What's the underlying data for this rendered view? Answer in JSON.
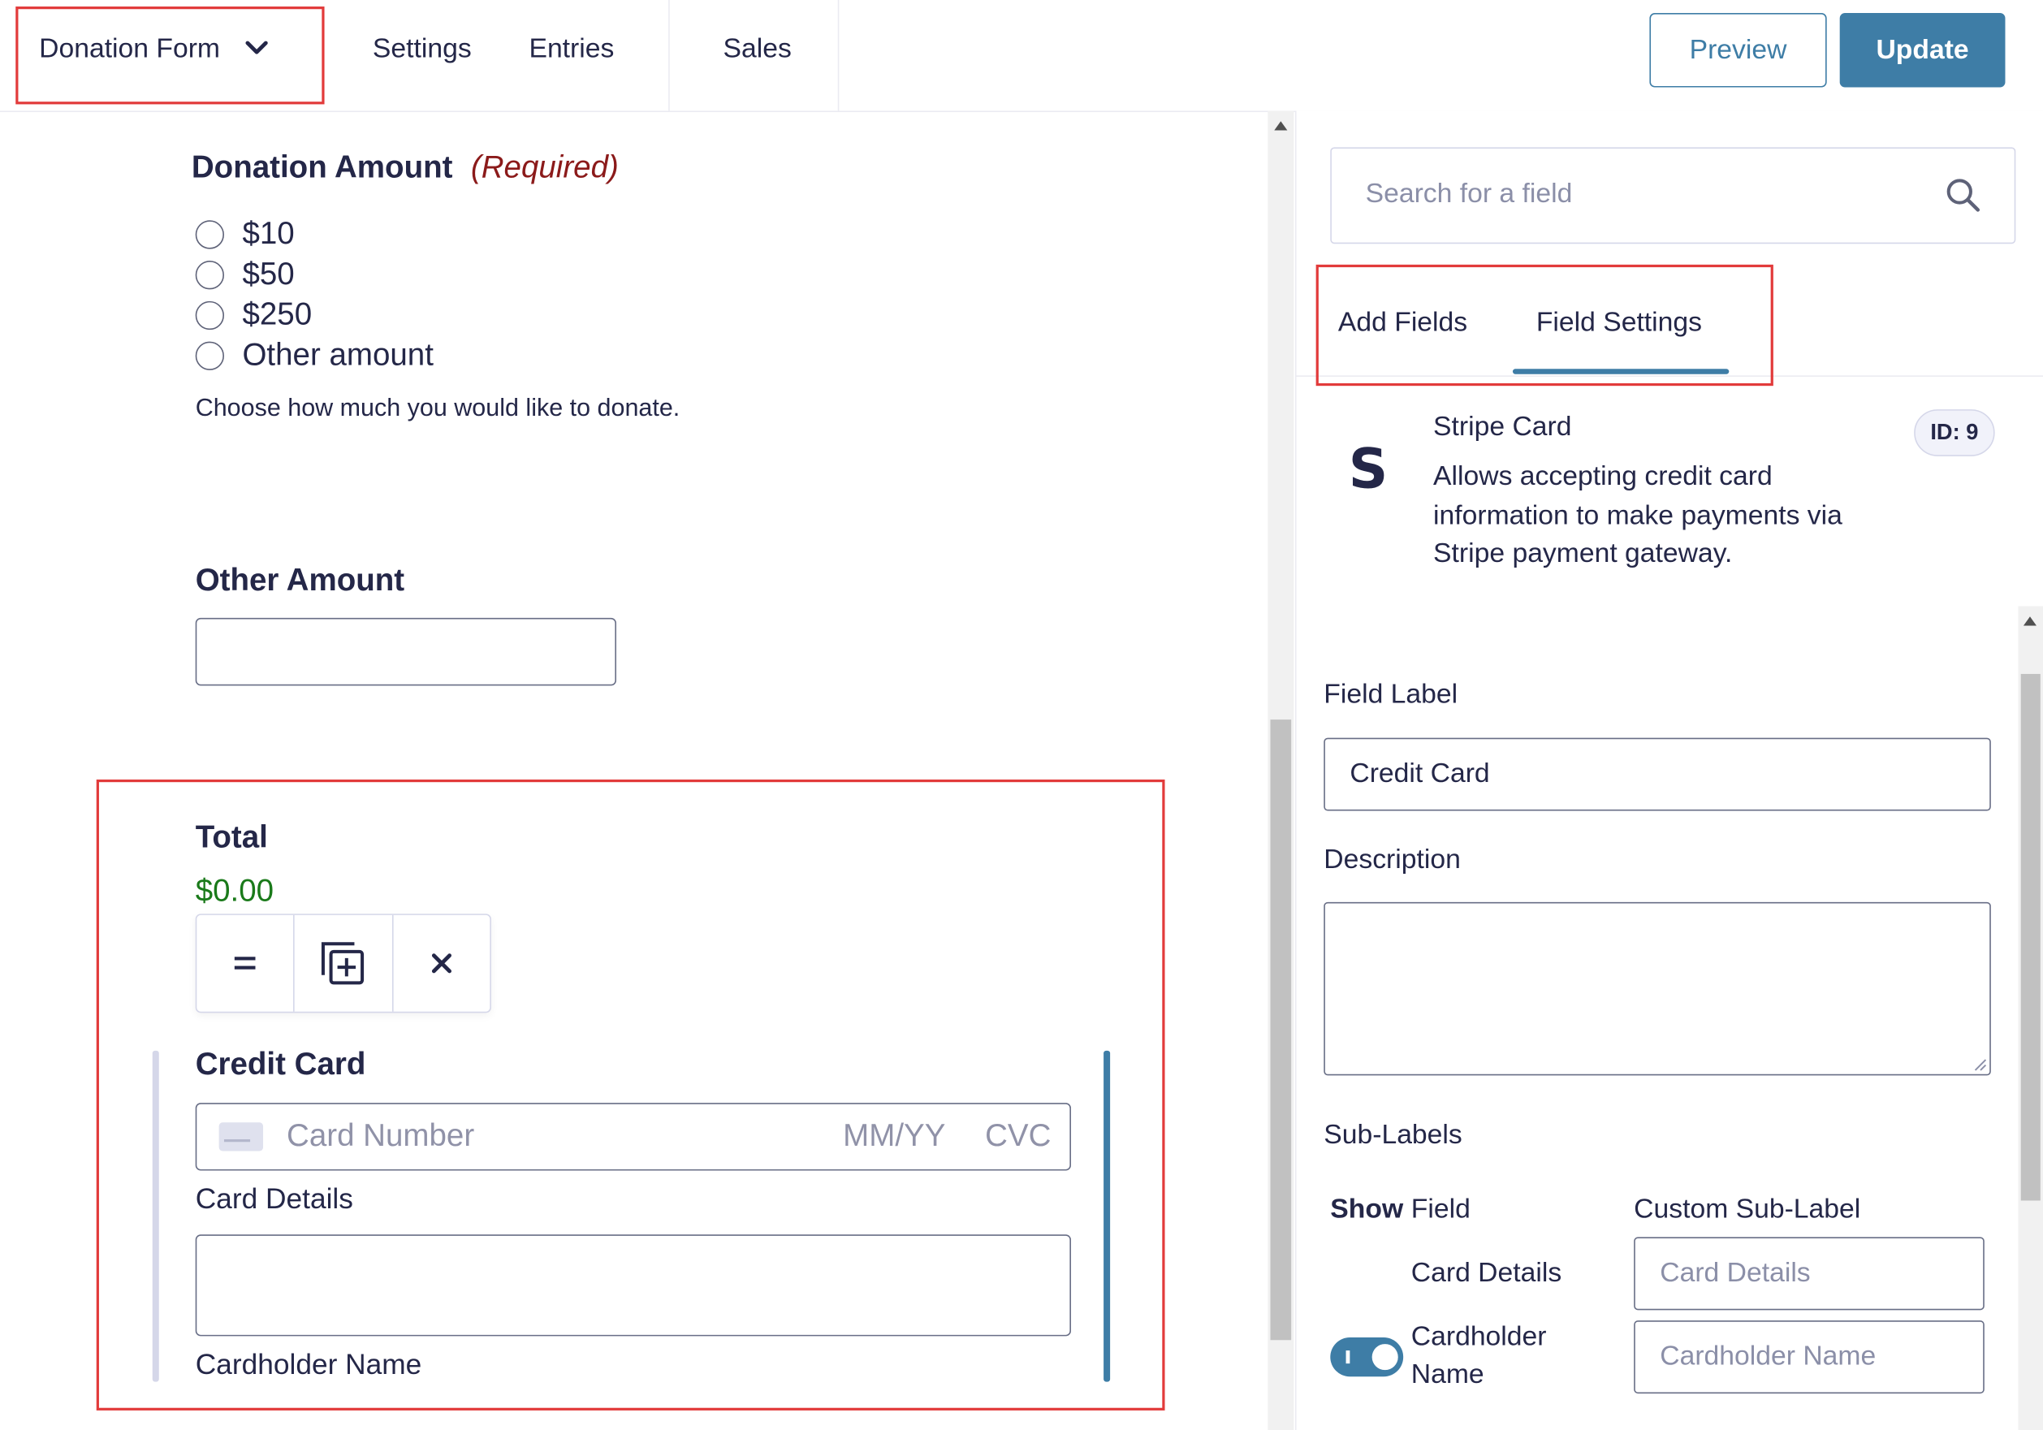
{
  "header": {
    "form_title": "Donation Form",
    "nav": [
      "Settings",
      "Entries",
      "Sales"
    ],
    "preview_label": "Preview",
    "update_label": "Update"
  },
  "canvas": {
    "donation": {
      "label": "Donation Amount",
      "required": "(Required)",
      "options": [
        "$10",
        "$50",
        "$250",
        "Other amount"
      ],
      "description": "Choose how much you would like to donate."
    },
    "other_amount": {
      "label": "Other Amount",
      "value": ""
    },
    "total": {
      "label": "Total",
      "value": "$0.00"
    },
    "credit_card": {
      "label": "Credit Card",
      "card_number_placeholder": "Card Number",
      "expiry_placeholder": "MM/YY",
      "cvc_placeholder": "CVC",
      "card_details_label": "Card Details",
      "cardholder_name_label": "Cardholder Name",
      "cardholder_value": ""
    }
  },
  "sidebar": {
    "search_placeholder": "Search for a field",
    "tabs": [
      "Add Fields",
      "Field Settings"
    ],
    "active_tab": "Field Settings",
    "field": {
      "title": "Stripe Card",
      "description": "Allows accepting credit card information to make payments via Stripe payment gateway.",
      "id_badge": "ID: 9",
      "icon_letter": "S"
    },
    "field_label": {
      "label": "Field Label",
      "value": "Credit Card"
    },
    "description": {
      "label": "Description",
      "value": ""
    },
    "sub_labels": {
      "label": "Sub-Labels",
      "col_show": "Show",
      "col_field": "Field",
      "col_custom": "Custom Sub-Label",
      "rows": [
        {
          "field": "Card Details",
          "placeholder": "Card Details",
          "toggle": null
        },
        {
          "field_line1": "Cardholder",
          "field_line2": "Name",
          "placeholder": "Cardholder Name",
          "toggle": true
        }
      ]
    }
  },
  "colors": {
    "accent": "#3e7da6",
    "highlight_border": "#e23b3b",
    "total_value": "#1a7a1a",
    "required": "#8b1a1a"
  }
}
